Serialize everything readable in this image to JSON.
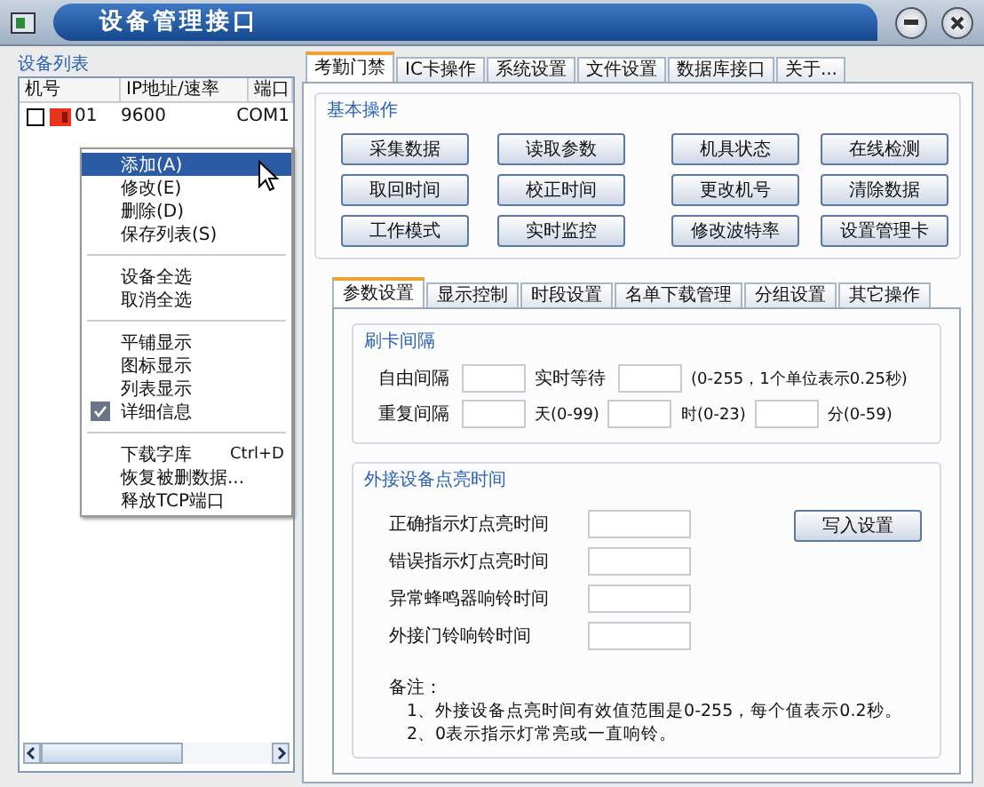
{
  "window": {
    "title": "设备管理接口"
  },
  "device_list": {
    "title": "设备列表",
    "columns": [
      "机号",
      "IP地址/速率",
      "端口"
    ],
    "rows": [
      {
        "checked": false,
        "cells": [
          "01",
          "9600",
          "COM1"
        ]
      }
    ]
  },
  "context_menu": [
    {
      "kind": "item",
      "label": "添加(A)",
      "selected": true,
      "checked": false
    },
    {
      "kind": "item",
      "label": "修改(E)",
      "selected": false,
      "checked": false
    },
    {
      "kind": "item",
      "label": "删除(D)",
      "selected": false,
      "checked": false
    },
    {
      "kind": "item",
      "label": "保存列表(S)",
      "selected": false,
      "checked": false
    },
    {
      "kind": "separator"
    },
    {
      "kind": "item",
      "label": "设备全选",
      "selected": false,
      "checked": false
    },
    {
      "kind": "item",
      "label": "取消全选",
      "selected": false,
      "checked": false
    },
    {
      "kind": "separator"
    },
    {
      "kind": "item",
      "label": "平铺显示",
      "selected": false,
      "checked": false
    },
    {
      "kind": "item",
      "label": "图标显示",
      "selected": false,
      "checked": false
    },
    {
      "kind": "item",
      "label": "列表显示",
      "selected": false,
      "checked": false
    },
    {
      "kind": "item",
      "label": "详细信息",
      "selected": false,
      "checked": true
    },
    {
      "kind": "separator"
    },
    {
      "kind": "item",
      "label": "下载字库",
      "shortcut": "Ctrl+D",
      "selected": false,
      "checked": false
    },
    {
      "kind": "item",
      "label": "恢复被删数据...",
      "selected": false,
      "checked": false
    },
    {
      "kind": "item",
      "label": "释放TCP端口",
      "selected": false,
      "checked": false
    }
  ],
  "tabs": [
    {
      "label": "考勤门禁",
      "selected": true
    },
    {
      "label": "IC卡操作",
      "selected": false
    },
    {
      "label": "系统设置",
      "selected": false
    },
    {
      "label": "文件设置",
      "selected": false
    },
    {
      "label": "数据库接口",
      "selected": false
    },
    {
      "label": "关于...",
      "selected": false
    }
  ],
  "basic_operations": {
    "title": "基本操作",
    "buttons": [
      "采集数据",
      "读取参数",
      "机具状态",
      "在线检测",
      "取回时间",
      "校正时间",
      "更改机号",
      "清除数据",
      "工作模式",
      "实时监控",
      "修改波特率",
      "设置管理卡"
    ]
  },
  "sub_tabs": [
    {
      "label": "参数设置",
      "selected": true
    },
    {
      "label": "显示控制",
      "selected": false
    },
    {
      "label": "时段设置",
      "selected": false
    },
    {
      "label": "名单下载管理",
      "selected": false
    },
    {
      "label": "分组设置",
      "selected": false
    },
    {
      "label": "其它操作",
      "selected": false
    }
  ],
  "card_interval": {
    "title": "刷卡间隔",
    "rows": [
      [
        {
          "kind": "label",
          "text": "自由间隔"
        },
        {
          "kind": "field"
        },
        {
          "kind": "label",
          "text": "实时等待"
        },
        {
          "kind": "field"
        },
        {
          "kind": "hint",
          "text": "(0-255，1个单位表示0.25秒)"
        }
      ],
      [
        {
          "kind": "label",
          "text": "重复间隔"
        },
        {
          "kind": "field"
        },
        {
          "kind": "hint",
          "text": "天(0-99)"
        },
        {
          "kind": "field"
        },
        {
          "kind": "hint",
          "text": "时(0-23)"
        },
        {
          "kind": "field"
        },
        {
          "kind": "hint",
          "text": "分(0-59)"
        }
      ]
    ]
  },
  "external_devices": {
    "title": "外接设备点亮时间",
    "fields": [
      "正确指示灯点亮时间",
      "错误指示灯点亮时间",
      "异常蜂鸣器响铃时间",
      "外接门铃响铃时间"
    ],
    "button": "写入设置",
    "note_title": "备注：",
    "notes": [
      "1、外接设备点亮时间有效值范围是0-255，每个值表示0.2秒。",
      "2、0表示指示灯常亮或一直响铃。"
    ]
  }
}
